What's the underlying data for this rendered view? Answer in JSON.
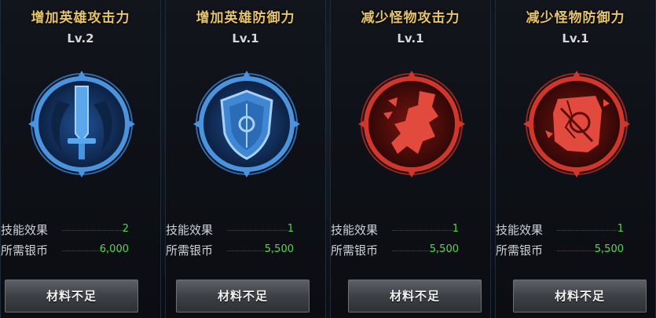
{
  "skills": [
    {
      "title": "增加英雄攻击力",
      "level": "Lv.2",
      "effect_label": "技能效果",
      "effect_value": "2",
      "cost_label": "所需银币",
      "cost_value": "6,000",
      "button_label": "材料不足",
      "icon": "sword-icon",
      "theme": "blue"
    },
    {
      "title": "增加英雄防御力",
      "level": "Lv.1",
      "effect_label": "技能效果",
      "effect_value": "1",
      "cost_label": "所需银币",
      "cost_value": "5,500",
      "button_label": "材料不足",
      "icon": "shield-icon",
      "theme": "blue"
    },
    {
      "title": "减少怪物攻击力",
      "level": "Lv.1",
      "effect_label": "技能效果",
      "effect_value": "1",
      "cost_label": "所需银币",
      "cost_value": "5,500",
      "button_label": "材料不足",
      "icon": "broken-claw-icon",
      "theme": "red"
    },
    {
      "title": "减少怪物防御力",
      "level": "Lv.1",
      "effect_label": "技能效果",
      "effect_value": "1",
      "cost_label": "所需银币",
      "cost_value": "5,500",
      "button_label": "材料不足",
      "icon": "broken-shield-icon",
      "theme": "red"
    }
  ],
  "colors": {
    "title": "#e7c46a",
    "value": "#55d64b",
    "blue_emblem": "#3b86d6",
    "red_emblem": "#d1362a"
  }
}
